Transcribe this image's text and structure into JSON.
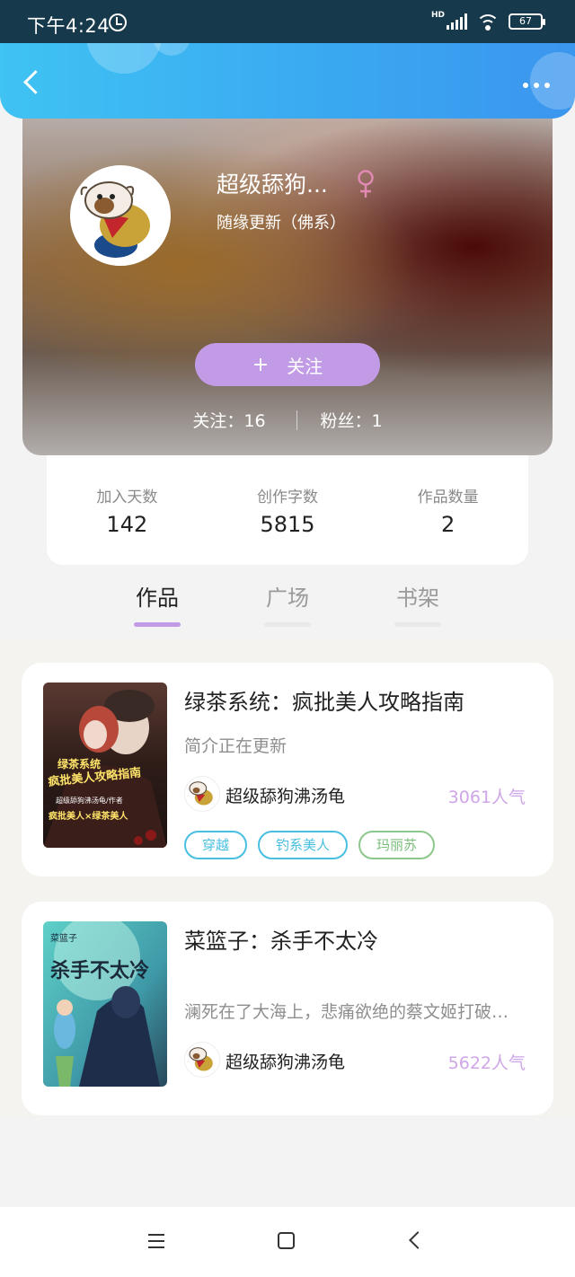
{
  "status_bar": {
    "time": "下午4:24",
    "network": "HD",
    "battery": "67"
  },
  "header": {
    "back_icon": "back-arrow-icon",
    "more_icon": "more-dots-icon"
  },
  "profile": {
    "username": "超级舔狗...",
    "gender": "female",
    "bio": "随缘更新（佛系）",
    "follow_plus": "+",
    "follow_label": "关注",
    "following": "关注：16",
    "fans": "粉丝：1"
  },
  "stats": [
    {
      "label": "加入天数",
      "value": "142"
    },
    {
      "label": "创作字数",
      "value": "5815"
    },
    {
      "label": "作品数量",
      "value": "2"
    }
  ],
  "tabs": [
    {
      "label": "作品",
      "active": true
    },
    {
      "label": "广场",
      "active": false
    },
    {
      "label": "书架",
      "active": false
    }
  ],
  "books": [
    {
      "title": "绿茶系统：疯批美人攻略指南",
      "description": "简介正在更新",
      "author": "超级舔狗沸汤龟",
      "popularity": "3061人气",
      "cover_text_1": "绿茶系统",
      "cover_text_2": "疯批美人攻略指南",
      "cover_text_3": "超级舔狗沸汤龟/作者",
      "cover_text_4": "疯批美人×绿茶美人",
      "tags": [
        {
          "label": "穿越",
          "color": "#49bfe0"
        },
        {
          "label": "钓系美人",
          "color": "#49bfe0"
        },
        {
          "label": "玛丽苏",
          "color": "#8cc88c"
        }
      ]
    },
    {
      "title": "菜篮子：杀手不太冷",
      "description": "澜死在了大海上，悲痛欲绝的蔡文姬打破…",
      "author": "超级舔狗沸汤龟",
      "popularity": "5622人气",
      "cover_text_1": "菜篮子",
      "cover_text_2": "杀手不太冷",
      "tags": []
    }
  ],
  "colors": {
    "header": "#3aa7f1",
    "accent_purple": "#c29be6",
    "popularity": "#cfa6e8"
  }
}
